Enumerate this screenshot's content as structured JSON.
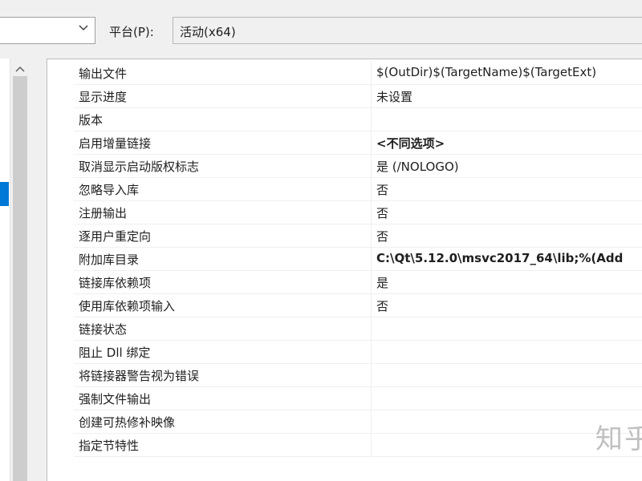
{
  "toolbar": {
    "configuration_value": "",
    "platform_label": "平台(P):",
    "platform_value": "活动(x64)"
  },
  "properties": [
    {
      "name": "输出文件",
      "value": "$(OutDir)$(TargetName)$(TargetExt)",
      "bold": false
    },
    {
      "name": "显示进度",
      "value": "未设置",
      "bold": false
    },
    {
      "name": "版本",
      "value": "",
      "bold": false
    },
    {
      "name": "启用增量链接",
      "value": "<不同选项>",
      "bold": true
    },
    {
      "name": "取消显示启动版权标志",
      "value": "是 (/NOLOGO)",
      "bold": false
    },
    {
      "name": "忽略导入库",
      "value": "否",
      "bold": false
    },
    {
      "name": "注册输出",
      "value": "否",
      "bold": false
    },
    {
      "name": "逐用户重定向",
      "value": "否",
      "bold": false
    },
    {
      "name": "附加库目录",
      "value": "C:\\Qt\\5.12.0\\msvc2017_64\\lib;%(Add",
      "bold": true
    },
    {
      "name": "链接库依赖项",
      "value": "是",
      "bold": false
    },
    {
      "name": "使用库依赖项输入",
      "value": "否",
      "bold": false
    },
    {
      "name": "链接状态",
      "value": "",
      "bold": false
    },
    {
      "name": "阻止 Dll 绑定",
      "value": "",
      "bold": false
    },
    {
      "name": "将链接器警告视为错误",
      "value": "",
      "bold": false
    },
    {
      "name": "强制文件输出",
      "value": "",
      "bold": false
    },
    {
      "name": "创建可热修补映像",
      "value": "",
      "bold": false
    },
    {
      "name": "指定节特性",
      "value": "",
      "bold": false
    }
  ],
  "watermark": "知乎",
  "icons": {
    "dropdown": "chevron-down-icon",
    "scroll_up": "chevron-up-icon"
  }
}
